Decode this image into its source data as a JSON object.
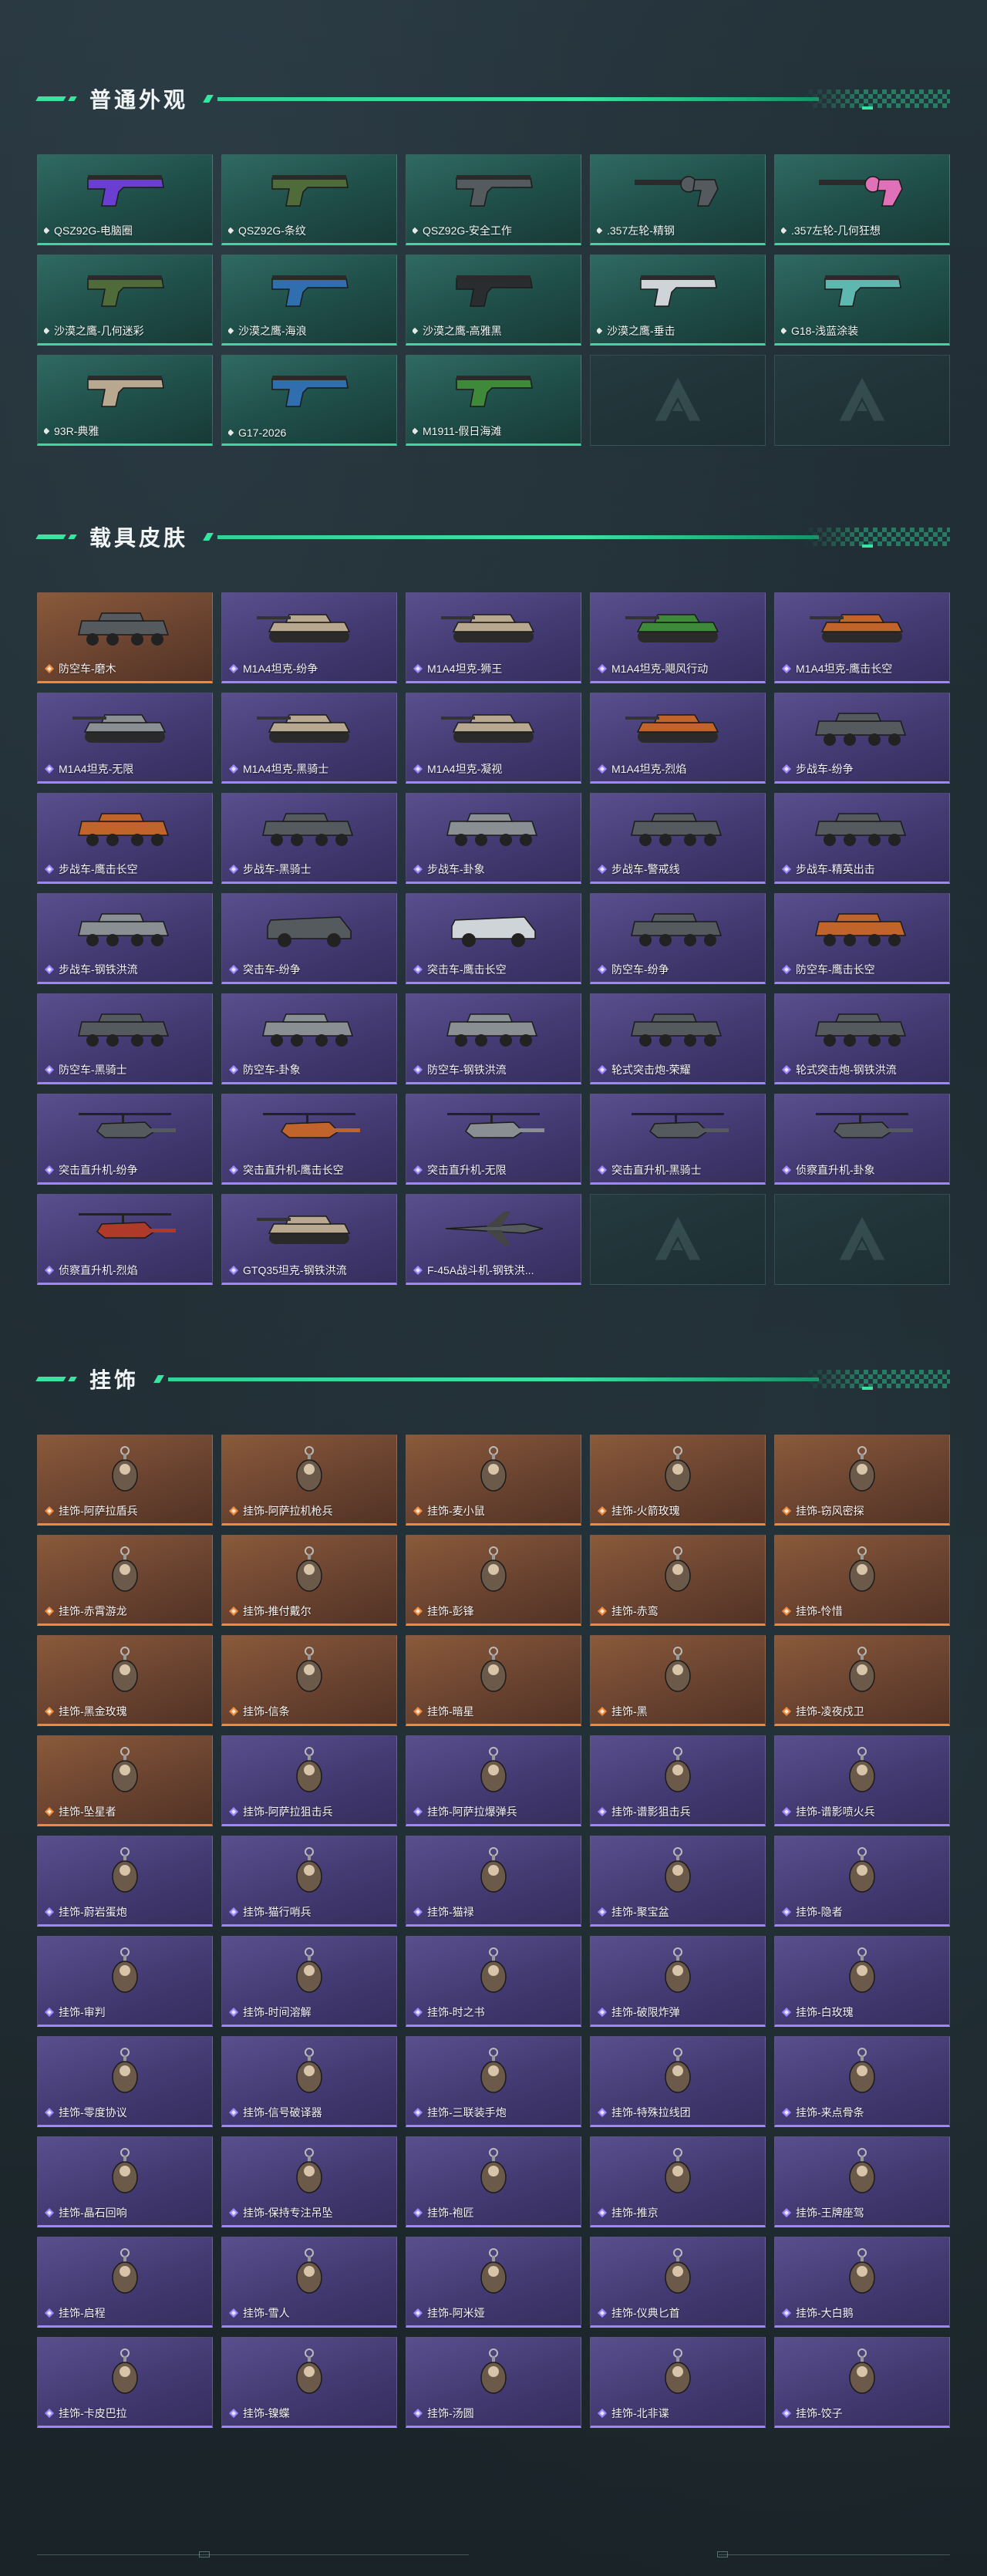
{
  "colors": {
    "accent": "#39e3a0",
    "rarity_green": "#3ad8a2",
    "rarity_purple": "#9d86ff",
    "rarity_orange": "#f08a3a"
  },
  "sections": {
    "weapon_skins": {
      "title": "普通外观",
      "items": [
        {
          "label": "QSZ92G-电脑圈",
          "rarity": "green",
          "icon": "pistol-purple-icon"
        },
        {
          "label": "QSZ92G-条纹",
          "rarity": "green",
          "icon": "pistol-camo-icon"
        },
        {
          "label": "QSZ92G-安全工作",
          "rarity": "green",
          "icon": "pistol-icon"
        },
        {
          "label": ".357左轮-精钢",
          "rarity": "green",
          "icon": "revolver-icon"
        },
        {
          "label": ".357左轮-几何狂想",
          "rarity": "green",
          "icon": "revolver-pink-icon"
        },
        {
          "label": "沙漠之鹰-几何迷彩",
          "rarity": "green",
          "icon": "deagle-camo-icon"
        },
        {
          "label": "沙漠之鹰-海浪",
          "rarity": "green",
          "icon": "deagle-blue-icon"
        },
        {
          "label": "沙漠之鹰-高雅黑",
          "rarity": "green",
          "icon": "deagle-black-icon"
        },
        {
          "label": "沙漠之鹰-垂击",
          "rarity": "green",
          "icon": "deagle-white-icon"
        },
        {
          "label": "G18-浅蓝涂装",
          "rarity": "green",
          "icon": "glock-teal-icon"
        },
        {
          "label": "93R-典雅",
          "rarity": "green",
          "icon": "pistol-tan-icon"
        },
        {
          "label": "G17-2026",
          "rarity": "green",
          "icon": "glock-blue-icon"
        },
        {
          "label": "M1911-假日海滩",
          "rarity": "green",
          "icon": "pistol-green-icon"
        },
        {
          "label": "",
          "rarity": "empty",
          "icon": "empty-slot-icon"
        },
        {
          "label": "",
          "rarity": "empty",
          "icon": "empty-slot-icon"
        }
      ]
    },
    "vehicle_skins": {
      "title": "载具皮肤",
      "items": [
        {
          "label": "防空车-磨木",
          "rarity": "orange",
          "icon": "aa-vehicle-icon"
        },
        {
          "label": "M1A4坦克-纷争",
          "rarity": "purple",
          "icon": "tank-icon"
        },
        {
          "label": "M1A4坦克-狮王",
          "rarity": "purple",
          "icon": "tank-icon"
        },
        {
          "label": "M1A4坦克-飓风行动",
          "rarity": "purple",
          "icon": "tank-green-icon"
        },
        {
          "label": "M1A4坦克-鹰击长空",
          "rarity": "purple",
          "icon": "tank-orange-icon"
        },
        {
          "label": "M1A4坦克-无限",
          "rarity": "purple",
          "icon": "tank-gray-icon"
        },
        {
          "label": "M1A4坦克-黑骑士",
          "rarity": "purple",
          "icon": "tank-icon"
        },
        {
          "label": "M1A4坦克-凝视",
          "rarity": "purple",
          "icon": "tank-icon"
        },
        {
          "label": "M1A4坦克-烈焰",
          "rarity": "purple",
          "icon": "tank-orange-icon"
        },
        {
          "label": "步战车-纷争",
          "rarity": "purple",
          "icon": "ifv-icon"
        },
        {
          "label": "步战车-鹰击长空",
          "rarity": "purple",
          "icon": "ifv-orange-icon"
        },
        {
          "label": "步战车-黑骑士",
          "rarity": "purple",
          "icon": "ifv-icon"
        },
        {
          "label": "步战车-卦象",
          "rarity": "purple",
          "icon": "ifv-gray-icon"
        },
        {
          "label": "步战车-警戒线",
          "rarity": "purple",
          "icon": "ifv-icon"
        },
        {
          "label": "步战车-精英出击",
          "rarity": "purple",
          "icon": "ifv-icon"
        },
        {
          "label": "步战车-钢铁洪流",
          "rarity": "purple",
          "icon": "ifv-gray-icon"
        },
        {
          "label": "突击车-纷争",
          "rarity": "purple",
          "icon": "assault-vehicle-icon"
        },
        {
          "label": "突击车-鹰击长空",
          "rarity": "purple",
          "icon": "assault-vehicle-white-icon"
        },
        {
          "label": "防空车-纷争",
          "rarity": "purple",
          "icon": "aa-vehicle-icon"
        },
        {
          "label": "防空车-鹰击长空",
          "rarity": "purple",
          "icon": "aa-vehicle-orange-icon"
        },
        {
          "label": "防空车-黑骑士",
          "rarity": "purple",
          "icon": "aa-vehicle-icon"
        },
        {
          "label": "防空车-卦象",
          "rarity": "purple",
          "icon": "aa-vehicle-gray-icon"
        },
        {
          "label": "防空车-钢铁洪流",
          "rarity": "purple",
          "icon": "aa-vehicle-gray-icon"
        },
        {
          "label": "轮式突击炮-荣耀",
          "rarity": "purple",
          "icon": "wheeled-gun-icon"
        },
        {
          "label": "轮式突击炮-钢铁洪流",
          "rarity": "purple",
          "icon": "wheeled-gun-icon"
        },
        {
          "label": "突击直升机-纷争",
          "rarity": "purple",
          "icon": "attack-heli-icon"
        },
        {
          "label": "突击直升机-鹰击长空",
          "rarity": "purple",
          "icon": "attack-heli-orange-icon"
        },
        {
          "label": "突击直升机-无限",
          "rarity": "purple",
          "icon": "attack-heli-gray-icon"
        },
        {
          "label": "突击直升机-黑骑士",
          "rarity": "purple",
          "icon": "attack-heli-icon"
        },
        {
          "label": "侦察直升机-卦象",
          "rarity": "purple",
          "icon": "scout-heli-icon"
        },
        {
          "label": "侦察直升机-烈焰",
          "rarity": "purple",
          "icon": "scout-heli-red-icon"
        },
        {
          "label": "GTQ35坦克-钢铁洪流",
          "rarity": "purple",
          "icon": "tank-icon"
        },
        {
          "label": "F-45A战斗机-钢铁洪...",
          "rarity": "purple",
          "icon": "jet-icon"
        },
        {
          "label": "",
          "rarity": "empty",
          "icon": "empty-slot-icon"
        },
        {
          "label": "",
          "rarity": "empty",
          "icon": "empty-slot-icon"
        }
      ]
    },
    "charms": {
      "title": "挂饰",
      "items": [
        {
          "label": "挂饰-阿萨拉盾兵",
          "rarity": "orange",
          "icon": "charm-soldier-icon"
        },
        {
          "label": "挂饰-阿萨拉机枪兵",
          "rarity": "orange",
          "icon": "charm-soldier-icon"
        },
        {
          "label": "挂饰-麦小鼠",
          "rarity": "orange",
          "icon": "charm-mouse-icon"
        },
        {
          "label": "挂饰-火箭玫瑰",
          "rarity": "orange",
          "icon": "charm-rocket-icon"
        },
        {
          "label": "挂饰-窃风密探",
          "rarity": "orange",
          "icon": "charm-figure-icon"
        },
        {
          "label": "挂饰-赤霄游龙",
          "rarity": "orange",
          "icon": "charm-dragon-icon"
        },
        {
          "label": "挂饰-推付戴尔",
          "rarity": "orange",
          "icon": "charm-tag-icon"
        },
        {
          "label": "挂饰-彭锋",
          "rarity": "orange",
          "icon": "charm-figure-icon"
        },
        {
          "label": "挂饰-赤鸾",
          "rarity": "orange",
          "icon": "charm-feather-icon"
        },
        {
          "label": "挂饰-怜惜",
          "rarity": "orange",
          "icon": "charm-feather-icon"
        },
        {
          "label": "挂饰-黑金玫瑰",
          "rarity": "orange",
          "icon": "charm-rose-icon"
        },
        {
          "label": "挂饰-信条",
          "rarity": "orange",
          "icon": "charm-tag-icon"
        },
        {
          "label": "挂饰-暗星",
          "rarity": "orange",
          "icon": "charm-feather-icon"
        },
        {
          "label": "挂饰-黑",
          "rarity": "orange",
          "icon": "charm-card-icon"
        },
        {
          "label": "挂饰-凌夜戍卫",
          "rarity": "orange",
          "icon": "charm-figure-icon"
        },
        {
          "label": "挂饰-坠星者",
          "rarity": "orange",
          "icon": "charm-crystal-icon"
        },
        {
          "label": "挂饰-阿萨拉狙击兵",
          "rarity": "purple",
          "icon": "charm-soldier-icon"
        },
        {
          "label": "挂饰-阿萨拉爆弹兵",
          "rarity": "purple",
          "icon": "charm-soldier-icon"
        },
        {
          "label": "挂饰-谱影狙击兵",
          "rarity": "purple",
          "icon": "charm-skull-icon"
        },
        {
          "label": "挂饰-谱影喷火兵",
          "rarity": "purple",
          "icon": "charm-skull-icon"
        },
        {
          "label": "挂饰-蔚岩蛋炮",
          "rarity": "purple",
          "icon": "charm-soldier-icon"
        },
        {
          "label": "挂饰-猫行哨兵",
          "rarity": "purple",
          "icon": "charm-soldier-icon"
        },
        {
          "label": "挂饰-猫禄",
          "rarity": "purple",
          "icon": "charm-cat-icon"
        },
        {
          "label": "挂饰-聚宝盆",
          "rarity": "purple",
          "icon": "charm-pot-icon"
        },
        {
          "label": "挂饰-隐者",
          "rarity": "purple",
          "icon": "charm-figure-icon"
        },
        {
          "label": "挂饰-审判",
          "rarity": "purple",
          "icon": "charm-tag-icon"
        },
        {
          "label": "挂饰-时间溶解",
          "rarity": "purple",
          "icon": "charm-clock-icon"
        },
        {
          "label": "挂饰-时之书",
          "rarity": "purple",
          "icon": "charm-book-icon"
        },
        {
          "label": "挂饰-破限炸弹",
          "rarity": "purple",
          "icon": "charm-bomb-icon"
        },
        {
          "label": "挂饰-白玫瑰",
          "rarity": "purple",
          "icon": "charm-rose-icon"
        },
        {
          "label": "挂饰-零度协议",
          "rarity": "purple",
          "icon": "charm-tag-icon"
        },
        {
          "label": "挂饰-信号破译器",
          "rarity": "purple",
          "icon": "charm-device-icon"
        },
        {
          "label": "挂饰-三联装手炮",
          "rarity": "purple",
          "icon": "charm-can-icon"
        },
        {
          "label": "挂饰-特殊拉线团",
          "rarity": "purple",
          "icon": "charm-device-icon"
        },
        {
          "label": "挂饰-来点骨条",
          "rarity": "purple",
          "icon": "charm-tag-icon"
        },
        {
          "label": "挂饰-晶石回响",
          "rarity": "purple",
          "icon": "charm-ring-icon"
        },
        {
          "label": "挂饰-保持专注吊坠",
          "rarity": "purple",
          "icon": "charm-sign-icon"
        },
        {
          "label": "挂饰-袍匠",
          "rarity": "purple",
          "icon": "charm-bag-icon"
        },
        {
          "label": "挂饰-推京",
          "rarity": "purple",
          "icon": "charm-hammer-icon"
        },
        {
          "label": "挂饰-王牌座驾",
          "rarity": "purple",
          "icon": "charm-plane-icon"
        },
        {
          "label": "挂饰-启程",
          "rarity": "purple",
          "icon": "charm-ring-icon"
        },
        {
          "label": "挂饰-雪人",
          "rarity": "purple",
          "icon": "charm-snowman-icon"
        },
        {
          "label": "挂饰-阿米娅",
          "rarity": "purple",
          "icon": "charm-figure-icon"
        },
        {
          "label": "挂饰-仪典匕首",
          "rarity": "purple",
          "icon": "charm-dagger-icon"
        },
        {
          "label": "挂饰-大白鹅",
          "rarity": "purple",
          "icon": "charm-goose-icon"
        },
        {
          "label": "挂饰-卡皮巴拉",
          "rarity": "purple",
          "icon": "charm-capybara-icon"
        },
        {
          "label": "挂饰-镍蝶",
          "rarity": "purple",
          "icon": "charm-butterfly-icon"
        },
        {
          "label": "挂饰-汤圆",
          "rarity": "purple",
          "icon": "charm-ball-icon"
        },
        {
          "label": "挂饰-北非谍",
          "rarity": "purple",
          "icon": "charm-figure-icon"
        },
        {
          "label": "挂饰-饺子",
          "rarity": "purple",
          "icon": "charm-dumpling-icon"
        }
      ]
    }
  }
}
